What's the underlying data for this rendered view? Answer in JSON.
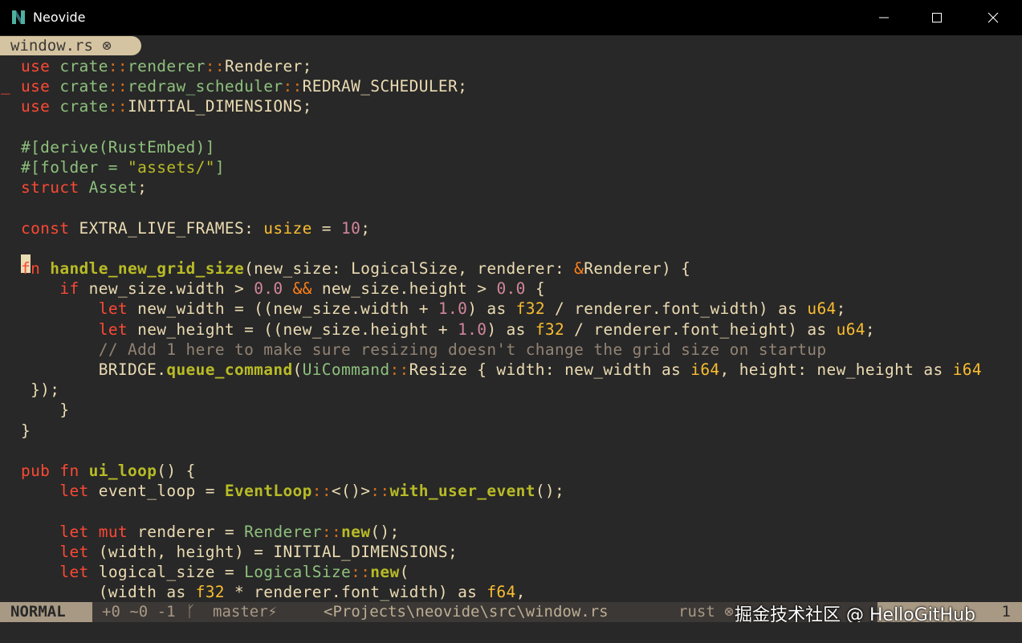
{
  "window": {
    "title": "Neovide",
    "logo_icon": "neovide-logo-icon",
    "controls": [
      "minimize-icon",
      "maximize-icon",
      "close-icon"
    ]
  },
  "tab": {
    "label": "window.rs ⊗"
  },
  "editor": {
    "lines": [
      "use crate::renderer::Renderer;",
      "use crate::redraw_scheduler::REDRAW_SCHEDULER;",
      "use crate::INITIAL_DIMENSIONS;",
      "",
      "#[derive(RustEmbed)]",
      "#[folder = \"assets/\"]",
      "struct Asset;",
      "",
      "const EXTRA_LIVE_FRAMES: usize = 10;",
      "",
      "fn handle_new_grid_size(new_size: LogicalSize, renderer: &Renderer) {",
      "    if new_size.width > 0.0 && new_size.height > 0.0 {",
      "        let new_width = ((new_size.width + 1.0) as f32 / renderer.font_width) as u64;",
      "        let new_height = ((new_size.height + 1.0) as f32 / renderer.font_height) as u64;",
      "        // Add 1 here to make sure resizing doesn't change the grid size on startup",
      "        BRIDGE.queue_command(UiCommand::Resize { width: new_width as i64, height: new_height as i64",
      " });",
      "    }",
      "}",
      "",
      "pub fn ui_loop() {",
      "    let event_loop = EventLoop::<()>::with_user_event();",
      "",
      "    let mut renderer = Renderer::new();",
      "    let (width, height) = INITIAL_DIMENSIONS;",
      "    let logical_size = LogicalSize::new(",
      "        (width as f32 * renderer.font_width) as f64,"
    ],
    "changed_line_marker": "_"
  },
  "statusline": {
    "mode": "NORMAL",
    "diff": "+0 ~0 -1",
    "branch_icon": "git-branch-icon",
    "branch": "master⚡",
    "path": "<Projects\\neovide\\src\\window.rs",
    "filetype": "rust ⊗",
    "position": "1"
  },
  "watermark": "掘金技术社区 @ HelloGitHub"
}
